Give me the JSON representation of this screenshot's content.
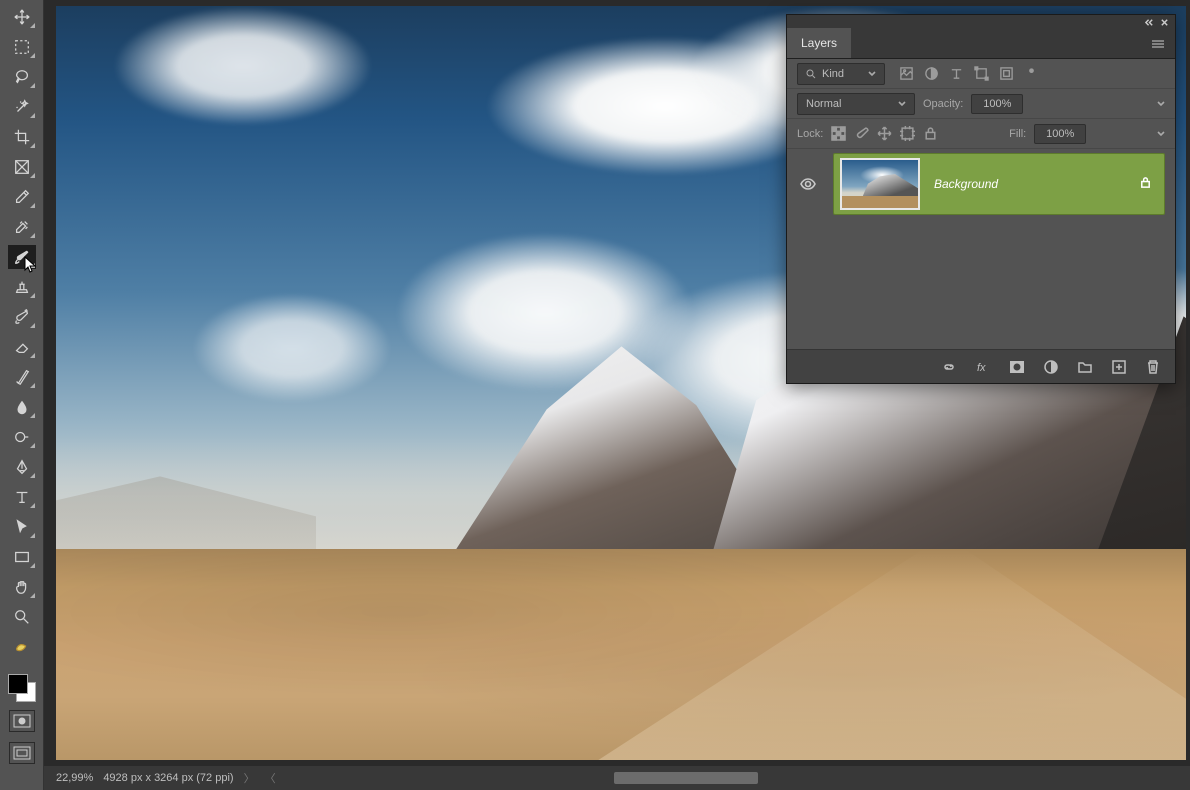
{
  "panel": {
    "title": "Layers",
    "filter_kind": "Kind",
    "blend_mode": "Normal",
    "opacity_label": "Opacity:",
    "opacity_value": "100%",
    "lock_label": "Lock:",
    "fill_label": "Fill:",
    "fill_value": "100%",
    "layer": {
      "name": "Background"
    }
  },
  "status": {
    "zoom": "22,99%",
    "dimensions": "4928 px x 3264 px (72 ppi)"
  },
  "colors": {
    "foreground": "#000000",
    "background": "#ffffff",
    "layer_highlight": "#7da045"
  }
}
